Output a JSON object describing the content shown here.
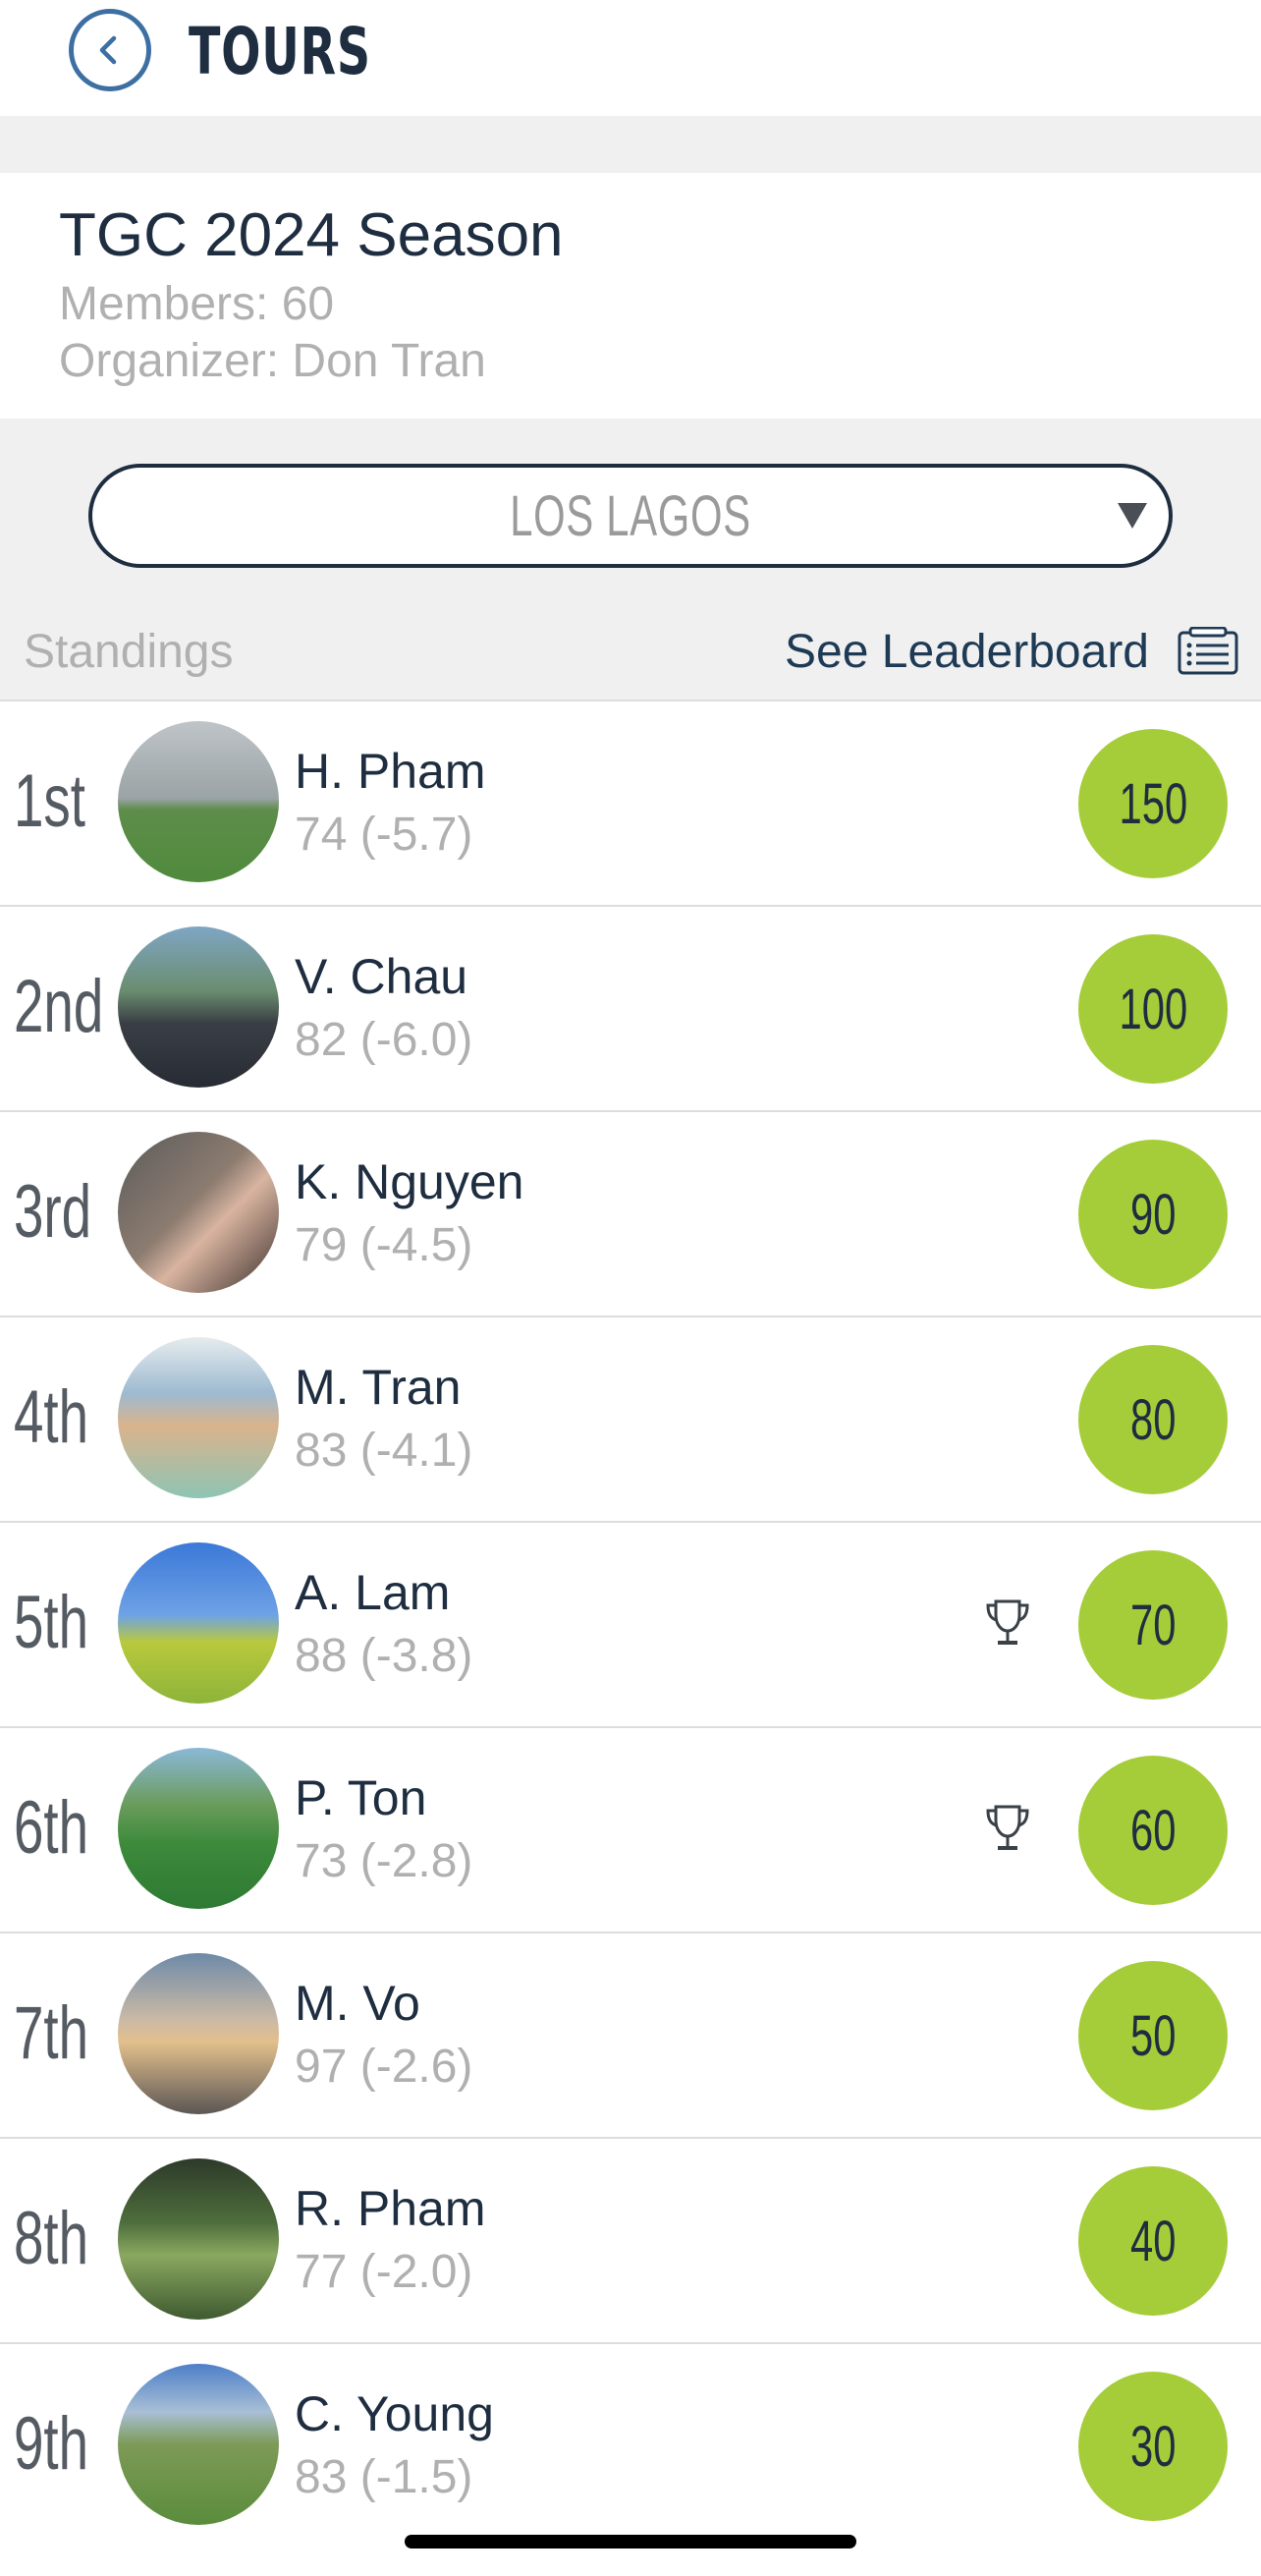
{
  "header": {
    "title": "TOURS",
    "back_icon": "chevron-left-icon"
  },
  "tour": {
    "name": "TGC 2024 Season",
    "members": "Members: 60",
    "organizer": "Organizer: Don Tran"
  },
  "course_select": {
    "selected": "LOS LAGOS"
  },
  "standings": {
    "label": "Standings",
    "leaderboard_link": "See Leaderboard",
    "rows": [
      {
        "rank": "1st",
        "name": "H. Pham",
        "score": "74 (-5.7)",
        "points": "150",
        "trophy": false
      },
      {
        "rank": "2nd",
        "name": "V. Chau",
        "score": "82 (-6.0)",
        "points": "100",
        "trophy": false
      },
      {
        "rank": "3rd",
        "name": "K. Nguyen",
        "score": "79 (-4.5)",
        "points": "90",
        "trophy": false
      },
      {
        "rank": "4th",
        "name": "M. Tran",
        "score": "83 (-4.1)",
        "points": "80",
        "trophy": false
      },
      {
        "rank": "5th",
        "name": "A. Lam",
        "score": "88 (-3.8)",
        "points": "70",
        "trophy": true
      },
      {
        "rank": "6th",
        "name": "P. Ton",
        "score": "73 (-2.8)",
        "points": "60",
        "trophy": true
      },
      {
        "rank": "7th",
        "name": "M. Vo",
        "score": "97 (-2.6)",
        "points": "50",
        "trophy": false
      },
      {
        "rank": "8th",
        "name": "R. Pham",
        "score": "77 (-2.0)",
        "points": "40",
        "trophy": false
      },
      {
        "rank": "9th",
        "name": "C. Young",
        "score": "83 (-1.5)",
        "points": "30",
        "trophy": false
      }
    ]
  },
  "colors": {
    "accent": "#a5cd3a",
    "text_dark": "#1e2e40",
    "muted": "#b0b0b0",
    "back_blue": "#3d6fa3"
  }
}
